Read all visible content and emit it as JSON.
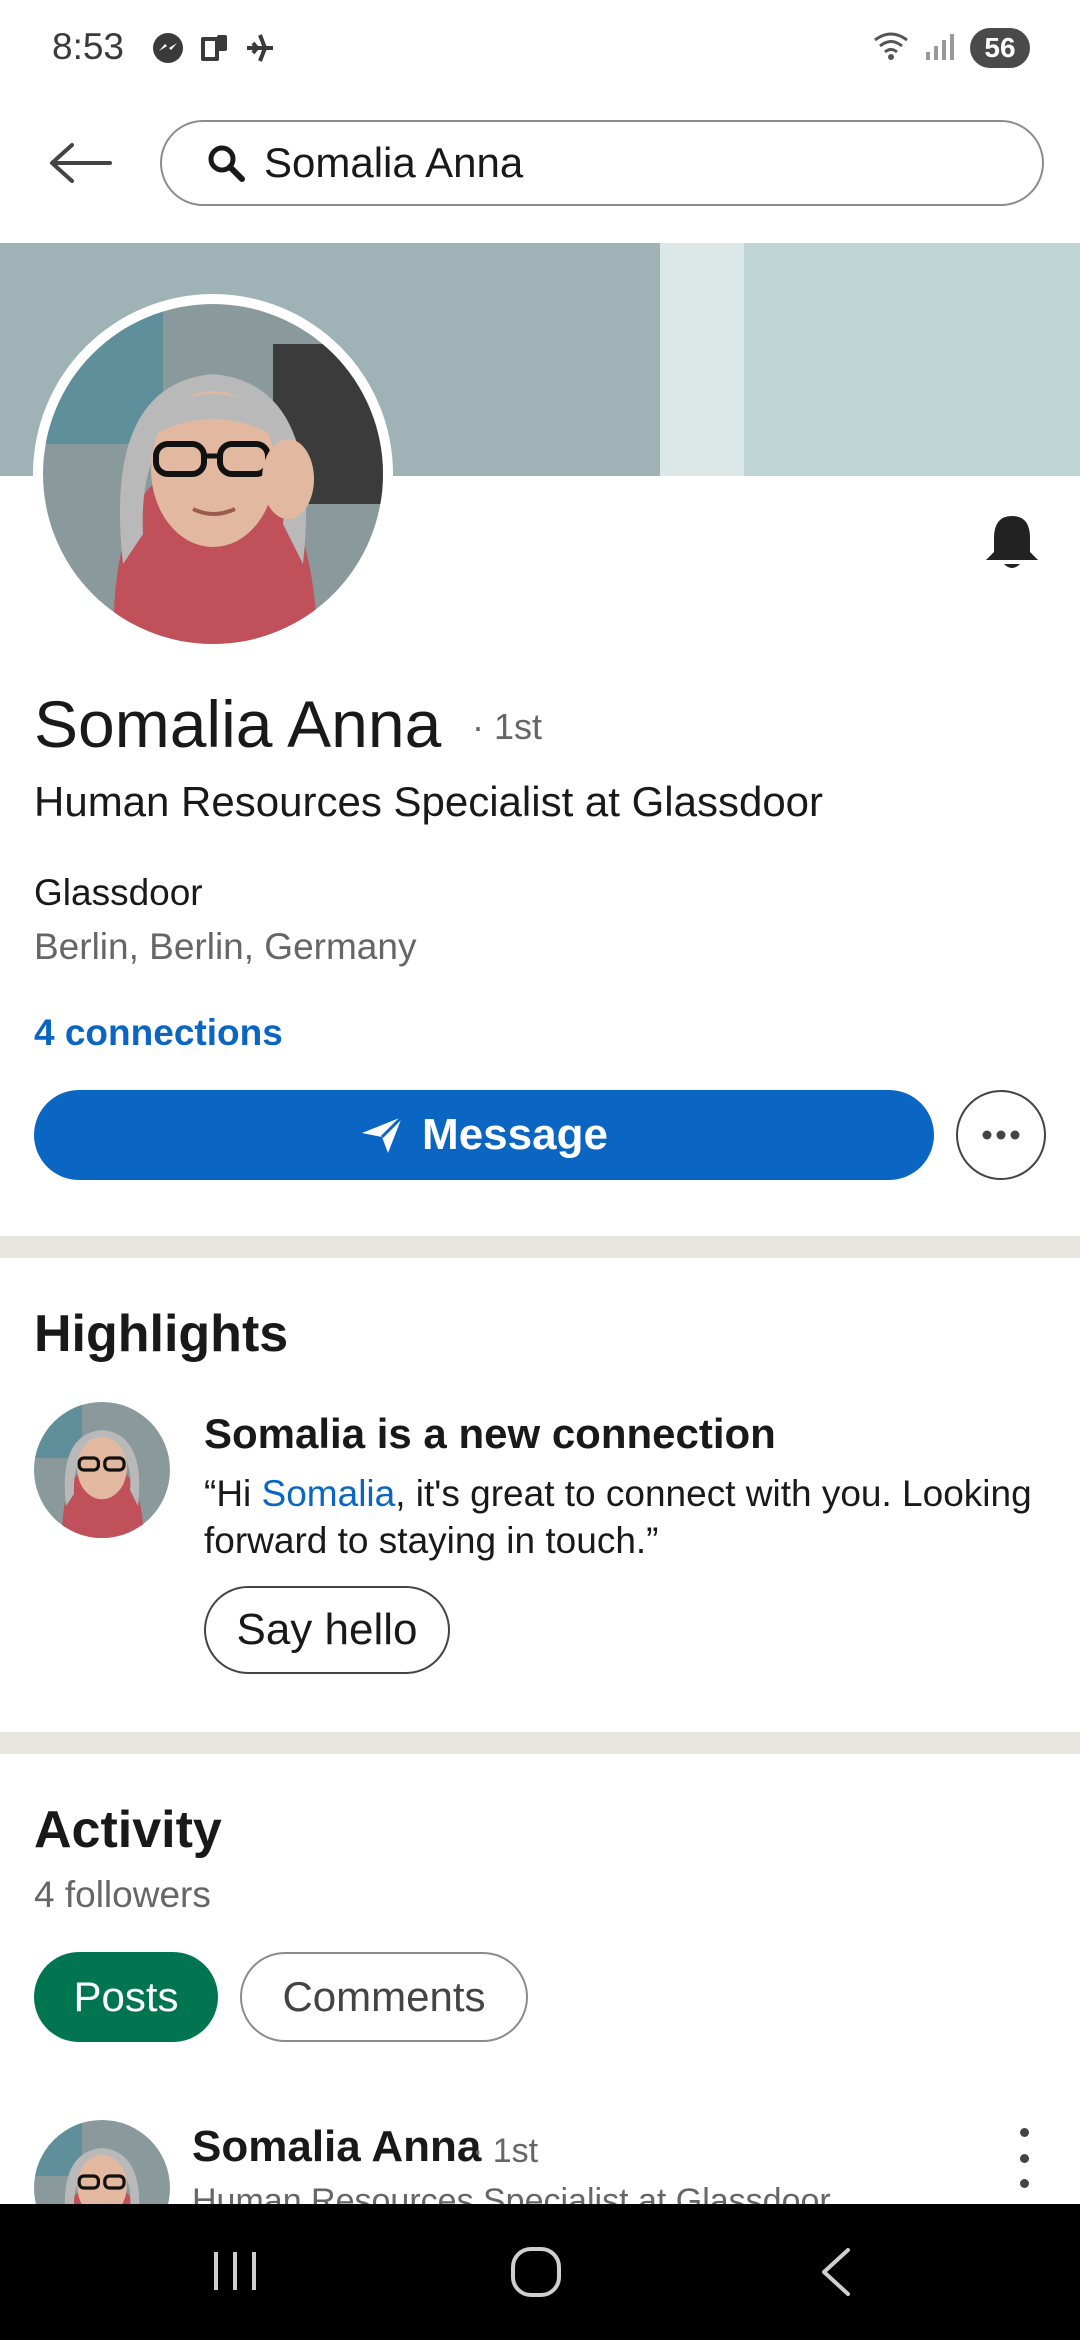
{
  "status_bar": {
    "time": "8:53",
    "battery": "56",
    "left_icons": [
      "messenger-icon",
      "phone-clipboard-icon",
      "airplane-icon"
    ],
    "right_icons": [
      "wifi-icon",
      "signal-icon"
    ]
  },
  "search": {
    "query": "Somalia Anna"
  },
  "profile": {
    "name": "Somalia Anna",
    "degree": "· 1st",
    "headline": "Human Resources Specialist at Glassdoor",
    "company": "Glassdoor",
    "location": "Berlin, Berlin, Germany",
    "connections": "4 connections",
    "message_label": "Message"
  },
  "highlights": {
    "title": "Highlights",
    "card_title": "Somalia is a new connection",
    "quote_open": "“Hi ",
    "quote_name": "Somalia",
    "quote_rest": ", it's great to connect with you. Looking forward to staying in touch.”",
    "say_hello_label": "Say hello"
  },
  "activity": {
    "title": "Activity",
    "followers": "4 followers",
    "tabs": [
      {
        "label": "Posts",
        "selected": true
      },
      {
        "label": "Comments",
        "selected": false
      }
    ],
    "post": {
      "author": "Somalia Anna",
      "degree": "· 1st",
      "subtitle": "Human Resources Specialist at Glassdoor"
    }
  },
  "colors": {
    "linkedin_blue": "#0a66c2",
    "selected_green": "#01754f",
    "cover_left": "#9fb2b6",
    "cover_right": "#bfd4d4"
  }
}
